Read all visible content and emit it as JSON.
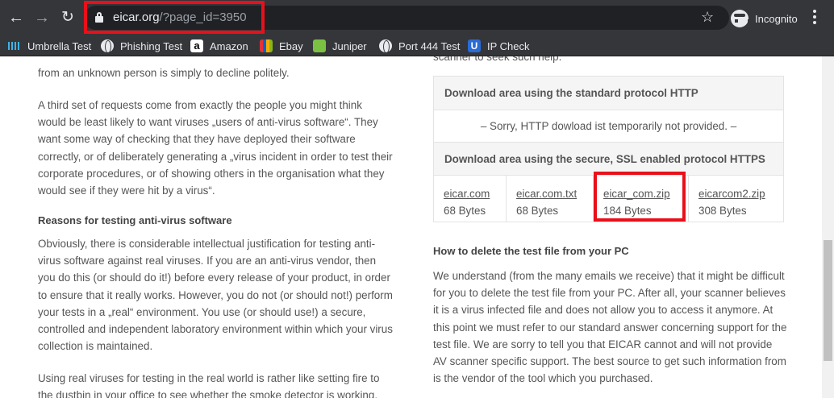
{
  "browser": {
    "url_host": "eicar.org",
    "url_path": "/?page_id=3950",
    "incognito_label": "Incognito",
    "bookmarks": [
      {
        "label": "Umbrella Test",
        "icon": "cisco-icon"
      },
      {
        "label": "Phishing Test",
        "icon": "globe-icon"
      },
      {
        "label": "Amazon",
        "icon": "amazon-icon"
      },
      {
        "label": "Ebay",
        "icon": "ebay-icon"
      },
      {
        "label": "Juniper",
        "icon": "juniper-icon"
      },
      {
        "label": "Port 444 Test",
        "icon": "globe-icon"
      },
      {
        "label": "IP Check",
        "icon": "ip-check-icon"
      }
    ]
  },
  "left_column": {
    "para0_tail": "from an unknown person is simply to decline politely.",
    "para1": "A third set of requests come from exactly the people you might think would be least likely to want viruses „users of anti-virus software“. They want some way of checking that they have deployed their software correctly, or of deliberately generating a „virus incident in order to test their corporate procedures, or of showing others in the organisation what they would see if they were hit by a virus“.",
    "heading": "Reasons for testing anti-virus software",
    "para2": "Obviously, there is considerable intellectual justification for testing anti-virus software against real viruses. If you are an anti-virus vendor, then you do this (or should do it!) before every release of your product, in order to ensure that it really works. However, you do not (or should not!) perform your tests in a „real“ environment. You use (or should use!) a secure, controlled and independent laboratory environment within which your virus collection is maintained.",
    "para3": "Using real viruses for testing in the real world is rather like setting fire to the dustbin in your office to see whether the smoke detector is working."
  },
  "right_column": {
    "top_fragment": "scanner to seek such help.",
    "download": {
      "http_header": "Download area using the standard protocol HTTP",
      "http_message": "– Sorry, HTTP dowload ist temporarily not provided. –",
      "https_header": "Download area using the secure, SSL enabled protocol HTTPS",
      "files": [
        {
          "name": "eicar.com",
          "size": "68 Bytes"
        },
        {
          "name": "eicar.com.txt",
          "size": "68 Bytes"
        },
        {
          "name": "eicar_com.zip",
          "size": "184 Bytes"
        },
        {
          "name": "eicarcom2.zip",
          "size": "308 Bytes"
        }
      ]
    },
    "heading": "How to delete the test file from your PC",
    "para": "We understand (from the many emails we receive) that it might be difficult for you to delete the test file from your PC. After all, your scanner believes it is a virus infected file and does not allow you to access it anymore. At this point we must refer to our standard answer concerning support for the test file. We are sorry to tell you that EICAR cannot and will not provide AV scanner specific support. The best source to get such information from is the vendor of the tool which you purchased."
  },
  "colors": {
    "chrome": "#35363a",
    "highlight": "#e8101a",
    "text": "#555555"
  }
}
